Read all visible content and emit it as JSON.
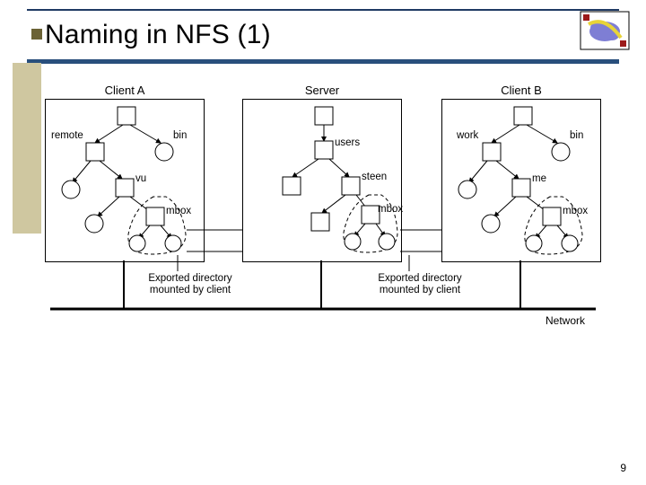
{
  "slide": {
    "title": "Naming in NFS (1)",
    "page_number": "9"
  },
  "diagram": {
    "panels": {
      "clientA": {
        "title": "Client A",
        "dirs": {
          "remote": "remote",
          "bin": "bin",
          "vu": "vu",
          "mbox": "mbox"
        }
      },
      "server": {
        "title": "Server",
        "dirs": {
          "users": "users",
          "steen": "steen",
          "mbox": "mbox"
        }
      },
      "clientB": {
        "title": "Client B",
        "dirs": {
          "work": "work",
          "bin": "bin",
          "me": "me",
          "mbox": "mbox"
        }
      }
    },
    "export_labelA": "Exported directory\nmounted by client",
    "export_labelB": "Exported directory\nmounted by client",
    "network_label": "Network"
  },
  "chart_data": {
    "type": "diagram",
    "description": "NFS naming illustration showing two clients mounting an exported directory from a common server; each machine depicted with a small directory tree (squares) and file leaves (circles).",
    "machines": [
      {
        "name": "Client A",
        "directory_tree": {
          "root": "/",
          "children": [
            {
              "name": "remote",
              "type": "dir",
              "children": [
                {
                  "type": "file"
                },
                {
                  "name": "vu",
                  "type": "dir",
                  "children": [
                    {
                      "type": "file"
                    },
                    {
                      "name": "mbox",
                      "type": "dir",
                      "mounted_from": "Server:/users/steen/mbox",
                      "children": [
                        {
                          "type": "file"
                        },
                        {
                          "type": "file"
                        }
                      ]
                    }
                  ]
                }
              ]
            },
            {
              "name": "bin",
              "type": "dir_leaf_circle"
            }
          ]
        }
      },
      {
        "name": "Server",
        "directory_tree": {
          "root": "/",
          "children": [
            {
              "name": "users",
              "type": "dir",
              "children": [
                {
                  "type": "dir"
                },
                {
                  "name": "steen",
                  "type": "dir",
                  "children": [
                    {
                      "type": "dir"
                    },
                    {
                      "name": "mbox",
                      "type": "dir",
                      "exported": true,
                      "children": [
                        {
                          "type": "file"
                        },
                        {
                          "type": "file"
                        }
                      ]
                    }
                  ]
                }
              ]
            }
          ]
        }
      },
      {
        "name": "Client B",
        "directory_tree": {
          "root": "/",
          "children": [
            {
              "name": "work",
              "type": "dir",
              "children": [
                {
                  "type": "file"
                },
                {
                  "name": "me",
                  "type": "dir",
                  "children": [
                    {
                      "type": "file"
                    },
                    {
                      "name": "mbox",
                      "type": "dir",
                      "mounted_from": "Server:/users/steen/mbox",
                      "children": [
                        {
                          "type": "file"
                        },
                        {
                          "type": "file"
                        }
                      ]
                    }
                  ]
                }
              ]
            },
            {
              "name": "bin",
              "type": "dir_leaf_circle"
            }
          ]
        }
      }
    ],
    "network_annotation": "Network"
  }
}
